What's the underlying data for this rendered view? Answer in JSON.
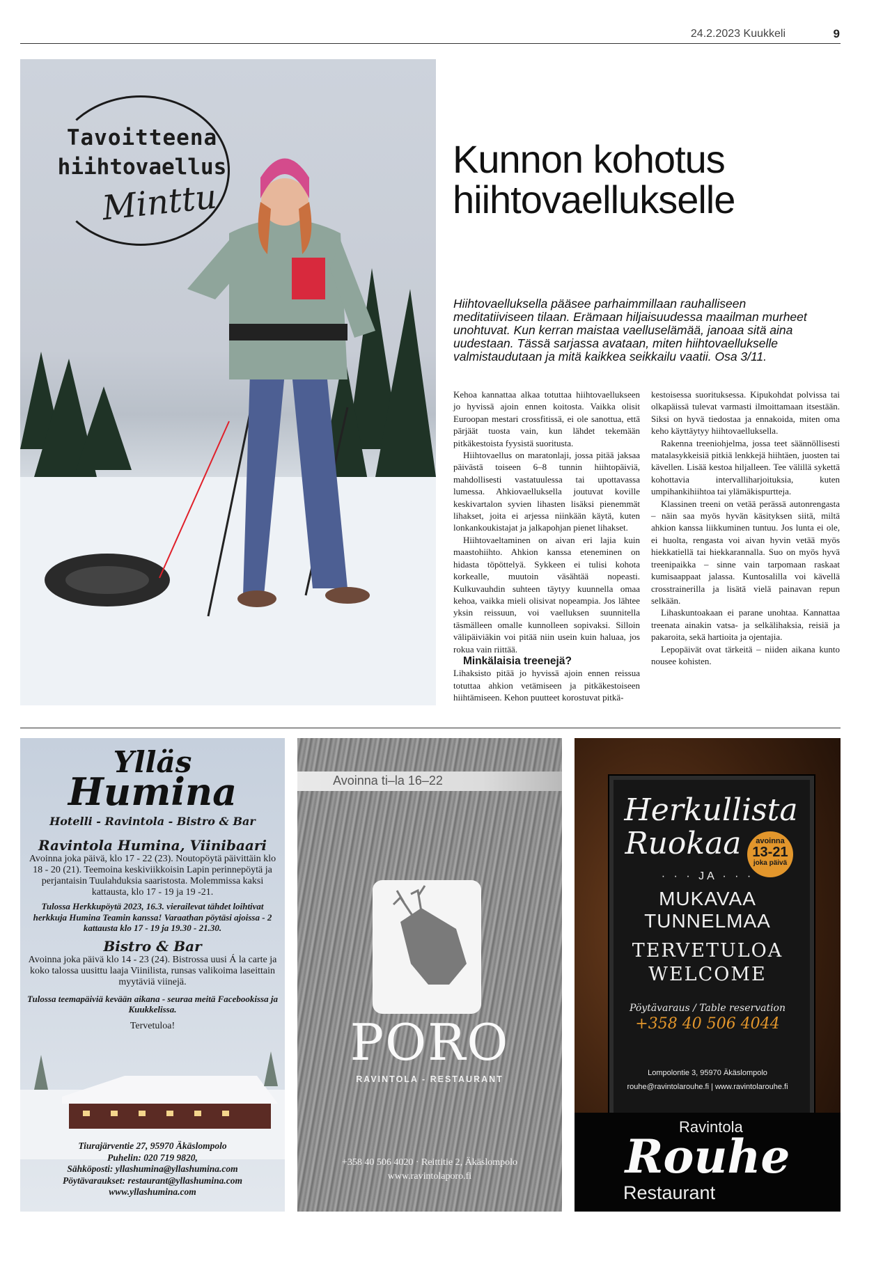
{
  "header": {
    "date_paper": "24.2.2023 Kuukkeli",
    "page_number": "9"
  },
  "hero": {
    "logo_line1": "Tavoitteena",
    "logo_line2": "hiihtovaellus",
    "logo_script": "Minttu"
  },
  "article": {
    "headline_line1": "Kunnon kohotus",
    "headline_line2": "hiihtovaellukselle",
    "lede": "Hiihtovaelluksella pääsee parhaimmillaan rauhalliseen meditatiiviseen tilaan. Erämaan hiljaisuudessa maailman murheet unohtuvat. Kun kerran maistaa vaellus­elämää, janoaa sitä aina uudestaan. Tässä sarjassa avataan, miten hiihtovaellukselle valmistaudutaan ja mitä kaikkea seikkailu vaatii. Osa 3/11.",
    "col1": [
      "Kehoa kannattaa alkaa totuttaa hiihtovaellukseen jo hyvissä ajoin ennen koitosta. Vaikka olisit Euroopan mestari crossfitissä, ei ole sanottua, että pärjäät tuosta vain, kun lähdet tekemään pitkäkestoista fyysistä suoritusta.",
      "Hiihtovaellus on maratonlaji, jossa pitää jaksaa päivästä toiseen 6–8 tunnin hiihtopäiviä, mahdollisesti vastatuulessa tai upottavassa lumessa. Ahkiovaelluksella joutuvat koville keskivartalon syvien lihasten lisäksi pienemmät lihakset, joita ei arjessa niinkään käytä, kuten lonkankoukistajat ja jalkapohjan pienet lihakset.",
      "Hiihtovaeltaminen on aivan eri lajia kuin maastohiihto. Ahkion kanssa eteneminen on hidasta töpöttelyä. Sykkeen ei tulisi kohota korkealle, muutoin väsähtää nopeasti. Kulkuvauhdin suhteen täytyy kuunnella omaa kehoa, vaikka mieli olisivat nopeampia. Jos lähtee yksin reissuun, voi vaelluksen suunnitella täsmälleen omalle kunnolleen sopivaksi. Silloin välipäiviäkin voi pitää niin usein kuin haluaa, jos rokua vain riittää."
    ],
    "subhead": "Minkälaisia treenejä?",
    "col1_after": "Lihaksisto pitää jo hyvissä ajoin ennen reissua totuttaa ahkion vetämiseen ja pitkäkestoiseen hiihtämiseen. Kehon puutteet korostuvat pitkä-",
    "col2": [
      "kestoisessa suorituksessa. Kipukohdat polvissa tai olkapäissä tulevat varmasti ilmoittamaan itsestään. Siksi on hyvä tiedostaa ja ennakoida, miten oma keho käyttäytyy hiihtovaelluksella.",
      "Rakenna treeniohjelma, jossa teet säännöllisesti matalasykkeisiä pitkiä lenkkejä hiihtäen, juosten tai kävellen. Lisää kestoa hiljalleen. Tee välillä sykettä kohottavia intervalliharjoituksia, kuten umpihankihiihtoa tai ylämäkispurtteja.",
      "Klassinen treeni on vetää perässä autonrengasta – näin saa myös hyvän käsityksen siitä, miltä ahkion kanssa liikkuminen tuntuu. Jos lunta ei ole, ei huolta, rengasta voi aivan hyvin vetää myös hiekkatiellä tai hiekkarannalla. Suo on myös hyvä treenipaikka – sinne vain tarpomaan raskaat kumisaappaat jalassa. Kuntosalilla voi kävellä crosstrainerilla ja lisätä vielä painavan repun selkään.",
      "Lihaskuntoakaan ei parane unohtaa. Kannattaa treenata ainakin vatsa- ja selkälihaksia, reisiä ja pakaroita, sekä hartioita ja ojentajia.",
      "Lepopäivät ovat tärkeitä – niiden aikana kunto nousee kohisten."
    ]
  },
  "ad_humina": {
    "brand1": "Ylläs",
    "brand2": "Humina",
    "subtitle": "Hotelli - Ravintola - Bistro & Bar",
    "h1": "Ravintola Humina, Viinibaari",
    "p1": "Avoinna joka päivä, klo 17 - 22 (23). Noutopöytä päivittäin klo 18 - 20 (21). Teemoina keskiviikkoisin Lapin perinnepöytä ja perjantaisin Tuulahduksia saaristosta. Molemmissa kaksi kattausta, klo 17 - 19 ja 19 -21.",
    "p1i": "Tulossa Herkkupöytä 2023, 16.3. vierailevat tähdet loihtivat herkkuja Humina Teamin kanssa! Varaathan pöytäsi ajoissa - 2 kattausta klo 17 - 19 ja 19.30 - 21.30.",
    "h2": "Bistro & Bar",
    "p2": "Avoinna joka päivä klo 14 - 23 (24). Bistrossa uusi Á la carte ja koko talossa uusittu laaja Viinilista, runsas valikoima laseittain myytäviä viinejä.",
    "p2i": "Tulossa teemapäiviä kevään aikana - seuraa meitä Facebookissa ja Kuukkelissa.",
    "welcome": "Tervetuloa!",
    "addr1": "Tiurajärventie 27, 95970 Äkäslompolo",
    "addr2": "Puhelin: 020 719 9820,",
    "addr3": "Sähköposti: yllashumina@yllashumina.com",
    "addr4": "Pöytävaraukset: restaurant@yllashumina.com",
    "addr5": "www.yllashumina.com"
  },
  "ad_poro": {
    "hours": "Avoinna ti–la 16–22",
    "name": "PORO",
    "tagline": "RAVINTOLA - RESTAURANT",
    "contact1": "+358 40 506 4020  ·  Reittitie 2, Äkäslompolo",
    "contact2": "www.ravintolaporo.fi"
  },
  "ad_rouhe": {
    "title1": "Herkullista",
    "title2": "Ruokaa",
    "badge1": "avoinna",
    "badge2": "13-21",
    "badge3": "joka päivä",
    "ja": "· · · JA · · ·",
    "mood": "MUKAVAA TUNNELMAA",
    "welcome1": "TERVETULOA",
    "welcome2": "WELCOME",
    "table": "Pöytävaraus / Table reservation",
    "phone": "+358 40 506 4044",
    "address": "Lompolontie 3, 95970 Äkäslompolo",
    "email": "rouhe@ravintolarouhe.fi | www.ravintolarouhe.fi",
    "foot1": "Ravintola",
    "foot2": "Rouhe",
    "foot3": "Restaurant"
  }
}
